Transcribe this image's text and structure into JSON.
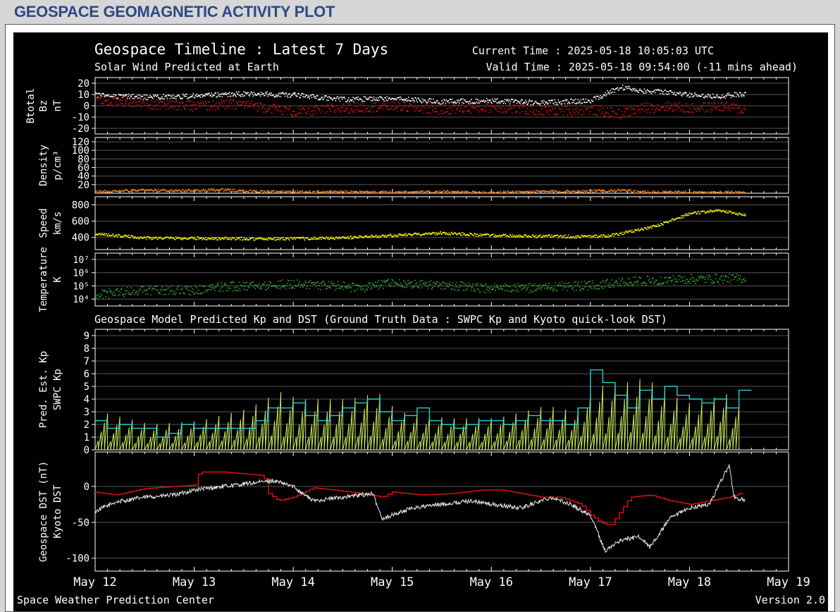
{
  "page": {
    "title": "GEOSPACE GEOMAGNETIC ACTIVITY PLOT"
  },
  "header": {
    "title": "Geospace Timeline : Latest 7 Days",
    "subtitle": "Solar Wind Predicted at Earth",
    "current_time": "Current Time : 2025-05-18 10:05:03 UTC",
    "valid_time": "Valid Time : 2025-05-18 09:54:00 (-11 mins ahead)"
  },
  "footer": {
    "left": "Space Weather Prediction Center",
    "right": "Version 2.0"
  },
  "colors": {
    "background": "#000000",
    "grid": "#555555",
    "text": "#ffffff",
    "btotal": "#ffffff",
    "bz": "#e01010",
    "density": "#ff8c1a",
    "speed": "#ffff00",
    "temperature": "#2fa82f",
    "pred_kp": "#c8e65a",
    "swpc_kp": "#2ccfd0",
    "geospace_dst": "#e8e8e8",
    "kyoto_dst": "#e01010"
  },
  "chart_data": [
    {
      "type": "scatter",
      "id": "mag",
      "ylabel": [
        "Btotal",
        "Bz",
        "nT"
      ],
      "ylim": [
        -25,
        25
      ],
      "yticks": [
        -20,
        -10,
        0,
        10,
        20
      ],
      "ytick_labels": [
        "-20",
        "-10",
        "0",
        "10",
        "20"
      ],
      "series": [
        {
          "name": "Btotal",
          "color": "#ffffff",
          "x": [
            0,
            0.5,
            1,
            1.5,
            2,
            2.5,
            3,
            3.5,
            4,
            4.5,
            5,
            5.3,
            5.5,
            5.8,
            6,
            6.3,
            6.56
          ],
          "y": [
            10,
            8,
            9,
            11,
            10,
            6,
            7,
            4,
            5,
            3,
            5,
            17,
            14,
            12,
            10,
            9,
            11
          ]
        },
        {
          "name": "Bz",
          "color": "#e01010",
          "x": [
            0,
            0.5,
            1,
            1.5,
            2,
            2.5,
            3,
            3.5,
            4,
            4.5,
            5,
            5.3,
            5.5,
            5.8,
            6,
            6.3,
            6.56
          ],
          "y": [
            7,
            2,
            0,
            2,
            -5,
            -2,
            0,
            -3,
            -1,
            -4,
            -3,
            -7,
            -2,
            0,
            -2,
            0,
            -3
          ]
        }
      ]
    },
    {
      "type": "scatter",
      "id": "density",
      "ylabel": [
        "Density",
        "p/cm³"
      ],
      "ylim": [
        0,
        130
      ],
      "yticks": [
        20,
        40,
        60,
        80,
        100,
        120
      ],
      "ytick_labels": [
        "20",
        "40",
        "60",
        "80",
        "100",
        "120"
      ],
      "series": [
        {
          "name": "Density",
          "color": "#ff8c1a",
          "x": [
            0,
            0.5,
            1,
            1.3,
            1.5,
            2,
            2.5,
            3,
            3.5,
            4,
            4.5,
            5,
            5.3,
            5.5,
            6,
            6.56
          ],
          "y": [
            5,
            8,
            7,
            9,
            6,
            4,
            4,
            3,
            4,
            3,
            5,
            6,
            8,
            4,
            3,
            3
          ]
        }
      ]
    },
    {
      "type": "scatter",
      "id": "speed",
      "ylabel": [
        "Speed",
        "km/s"
      ],
      "ylim": [
        250,
        900
      ],
      "yticks": [
        400,
        600,
        800
      ],
      "ytick_labels": [
        "400",
        "600",
        "800"
      ],
      "series": [
        {
          "name": "Speed",
          "color": "#ffff00",
          "x": [
            0,
            0.5,
            1,
            1.5,
            2,
            2.5,
            3,
            3.5,
            4,
            4.5,
            5,
            5.2,
            5.5,
            5.7,
            6,
            6.3,
            6.56
          ],
          "y": [
            450,
            400,
            395,
            390,
            390,
            400,
            430,
            460,
            430,
            420,
            415,
            430,
            500,
            560,
            700,
            740,
            680
          ]
        }
      ]
    },
    {
      "type": "scatter",
      "id": "temperature",
      "ylabel": [
        "Temperature",
        "K"
      ],
      "yscale": "log",
      "ylim": [
        3000,
        30000000
      ],
      "yticks": [
        10000,
        100000,
        1000000,
        10000000
      ],
      "ytick_labels": [
        "10⁴",
        "10⁵",
        "10⁶",
        "10⁷"
      ],
      "series": [
        {
          "name": "Temperature",
          "color": "#2fa82f",
          "x": [
            0,
            0.5,
            1,
            1.2,
            1.5,
            2,
            2.5,
            2.7,
            3,
            3.5,
            4,
            4.5,
            5,
            5.5,
            6,
            6.56
          ],
          "y": [
            20000,
            50000,
            50000,
            90000,
            100000,
            150000,
            100000,
            60000,
            200000,
            120000,
            70000,
            80000,
            120000,
            250000,
            350000,
            400000
          ]
        }
      ]
    },
    {
      "type": "line",
      "id": "kp",
      "title": "Geospace Model Predicted Kp and DST (Ground Truth Data : SWPC Kp and Kyoto quick-look DST)",
      "ylabel": [
        "Pred. Est. Kp",
        "SWPC Kp"
      ],
      "ylim": [
        0,
        9.5
      ],
      "yticks": [
        0,
        1,
        2,
        3,
        4,
        5,
        6,
        7,
        8,
        9
      ],
      "ytick_labels": [
        "0",
        "1",
        "2",
        "3",
        "4",
        "5",
        "6",
        "7",
        "8",
        "9"
      ],
      "pred_kp": {
        "name": "Pred. Est. Kp",
        "color": "#c8e65a",
        "x": [
          0,
          0.5,
          1,
          1.5,
          1.8,
          2,
          2.5,
          2.8,
          3,
          3.5,
          4,
          4.5,
          4.8,
          5,
          5.3,
          5.5,
          5.7,
          6,
          6.3,
          6.5
        ],
        "y": [
          3,
          2,
          2.3,
          3.3,
          4.6,
          4,
          4,
          4.5,
          3,
          2.5,
          2.5,
          3.5,
          3,
          5,
          5.3,
          5.7,
          4.5,
          3.5,
          4.5,
          3
        ]
      },
      "swpc_kp": {
        "name": "SWPC Kp",
        "color": "#2ccfd0",
        "x": [
          0,
          0.125,
          0.25,
          0.375,
          0.5,
          0.625,
          0.75,
          0.875,
          1,
          1.125,
          1.25,
          1.375,
          1.5,
          1.625,
          1.75,
          1.875,
          2,
          2.125,
          2.25,
          2.375,
          2.5,
          2.625,
          2.75,
          2.875,
          3,
          3.125,
          3.25,
          3.375,
          3.5,
          3.625,
          3.75,
          3.875,
          4,
          4.125,
          4.25,
          4.375,
          4.5,
          4.625,
          4.75,
          4.875,
          5,
          5.125,
          5.25,
          5.375,
          5.5,
          5.625,
          5.75,
          5.875,
          6,
          6.125,
          6.25,
          6.375,
          6.5
        ],
        "y": [
          2.3,
          1.7,
          2,
          1.7,
          1.7,
          1,
          1.3,
          2,
          1.7,
          1.7,
          1.7,
          1.7,
          1.7,
          2.3,
          3.3,
          3.3,
          3.7,
          2.7,
          2.3,
          2.7,
          3.3,
          3.7,
          4,
          3,
          2.3,
          2.7,
          3.3,
          2.3,
          2,
          1.7,
          2,
          2.3,
          2.3,
          2,
          2.3,
          2.7,
          2.3,
          2.3,
          2,
          3.3,
          6.3,
          5.3,
          4.3,
          3.3,
          4.7,
          4,
          5,
          4.3,
          4,
          3.7,
          4,
          3.3,
          4.7
        ]
      }
    },
    {
      "type": "line",
      "id": "dst",
      "ylabel": [
        "Geospace DST (nT)",
        "Kyoto DST"
      ],
      "ylim": [
        -118,
        48
      ],
      "yticks": [
        -100,
        -50,
        0
      ],
      "ytick_labels": [
        "-100",
        "-50",
        "0"
      ],
      "geospace_dst": {
        "name": "Geospace DST",
        "color": "#e8e8e8",
        "x": [
          0,
          0.2,
          0.5,
          0.8,
          1,
          1.3,
          1.6,
          1.8,
          2,
          2.2,
          2.5,
          2.8,
          2.9,
          3.2,
          3.5,
          3.8,
          4,
          4.3,
          4.6,
          4.8,
          5,
          5.15,
          5.3,
          5.5,
          5.6,
          5.8,
          6,
          6.2,
          6.4,
          6.45,
          6.56
        ],
        "y": [
          -35,
          -22,
          -15,
          -12,
          -5,
          0,
          5,
          8,
          0,
          -20,
          -15,
          -10,
          -45,
          -30,
          -25,
          -20,
          -25,
          -30,
          -15,
          -25,
          -40,
          -90,
          -75,
          -70,
          -85,
          -45,
          -30,
          -25,
          30,
          -15,
          -20
        ]
      },
      "kyoto_dst": {
        "name": "Kyoto DST",
        "color": "#e01010",
        "x": [
          0,
          0.2,
          0.5,
          0.8,
          1,
          1.05,
          1.3,
          1.7,
          1.75,
          1.85,
          2,
          2.2,
          2.4,
          2.7,
          2.9,
          3,
          3.3,
          3.6,
          3.9,
          4.1,
          4.3,
          4.5,
          4.7,
          4.9,
          5,
          5.1,
          5.2,
          5.3,
          5.4,
          5.6,
          5.8,
          6,
          6.2,
          6.4,
          6.5
        ],
        "y": [
          -8,
          -12,
          -3,
          0,
          2,
          20,
          20,
          15,
          -10,
          -20,
          -15,
          -2,
          -5,
          -10,
          -15,
          -8,
          -12,
          -10,
          -5,
          -5,
          -10,
          -15,
          -15,
          -25,
          -40,
          -50,
          -55,
          -35,
          -15,
          -12,
          -20,
          -25,
          -20,
          -15,
          -10
        ]
      }
    }
  ],
  "xaxis": {
    "tick_labels": [
      "May 12",
      "May 13",
      "May 14",
      "May 15",
      "May 16",
      "May 17",
      "May 18",
      "May 19"
    ]
  }
}
